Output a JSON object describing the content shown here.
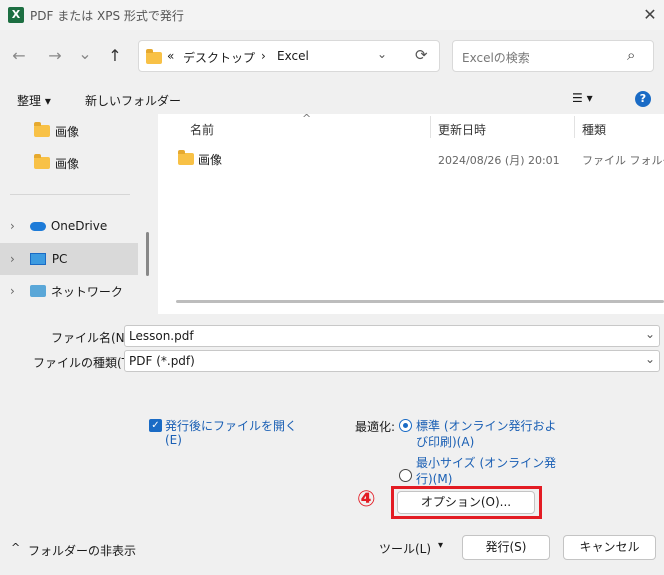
{
  "window": {
    "title": "PDF または XPS 形式で発行",
    "app_icon": "X",
    "close": "✕"
  },
  "nav": {
    "back": "←",
    "forward": "→",
    "recent": "⌄",
    "up": "↑",
    "breadcrumb": {
      "chevron": "«",
      "parts": [
        "デスクトップ",
        "Excel"
      ],
      "separator": "›"
    },
    "dropdown": "⌄",
    "refresh": "⟳",
    "search_placeholder": "Excelの検索",
    "search_icon": "⌕"
  },
  "toolbar": {
    "organize": "整理 ▾",
    "new_folder": "新しいフォルダー",
    "view": "☰ ▾",
    "help": "?"
  },
  "leftnav": {
    "folders": [
      "画像",
      "画像"
    ],
    "items": [
      {
        "label": "OneDrive",
        "icon": "cloud-icon"
      },
      {
        "label": "PC",
        "icon": "pc-icon"
      },
      {
        "label": "ネットワーク",
        "icon": "network-icon"
      }
    ],
    "expand": "›"
  },
  "files": {
    "columns": [
      "名前",
      "更新日時",
      "種類"
    ],
    "sort_arrow": "^",
    "rows": [
      {
        "name": "画像",
        "date": "2024/08/26 (月) 20:01",
        "type": "ファイル フォルダー"
      }
    ]
  },
  "form": {
    "filename_label": "ファイル名(N):",
    "filename_value": "Lesson.pdf",
    "filetype_label": "ファイルの種類(T):",
    "filetype_value": "PDF (*.pdf)",
    "open_after_line1": "発行後にファイルを開く",
    "open_after_line2": "(E)",
    "optimize_label": "最適化:",
    "opt_std_line1": "標準 (オンライン発行およ",
    "opt_std_line2": "び印刷)(A)",
    "opt_min_line1": "最小サイズ (オンライン発",
    "opt_min_line2": "行)(M)",
    "options_button": "オプション(O)...",
    "annotation_number": "④"
  },
  "footer": {
    "hide_folders": "フォルダーの非表示",
    "hide_arrow": "^",
    "tools": "ツール(L)",
    "tools_arrow": "▾",
    "publish": "発行(S)",
    "cancel": "キャンセル"
  },
  "colors": {
    "accent": "#1a6bc5",
    "highlight": "#e31b23",
    "excel_green": "#1d6f42"
  }
}
